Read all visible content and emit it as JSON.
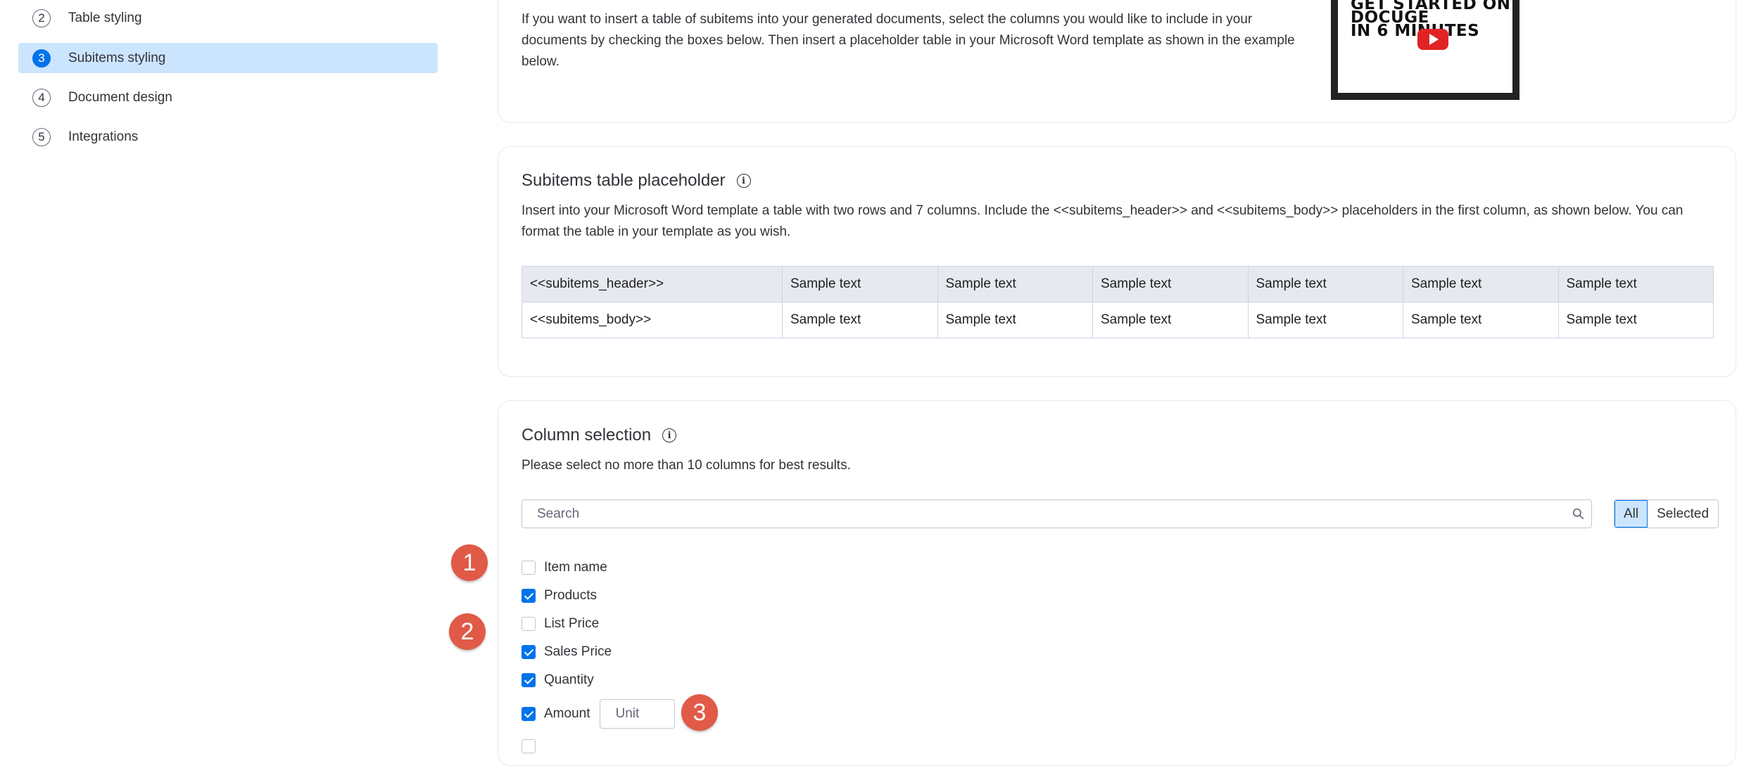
{
  "sidebar": {
    "steps": [
      {
        "number": "2",
        "label": "Table styling",
        "active": false
      },
      {
        "number": "3",
        "label": "Subitems styling",
        "active": true
      },
      {
        "number": "4",
        "label": "Document design",
        "active": false
      },
      {
        "number": "5",
        "label": "Integrations",
        "active": false
      }
    ]
  },
  "intro": {
    "text": "If you want to insert a table of subitems into your generated documents, select the columns you would like to include in your documents by checking the boxes below. Then insert a placeholder table in your Microsoft Word template as shown in the example below.",
    "video": {
      "line1": "GET STARTED ON",
      "line2": "DOCUGEN",
      "line3": "IN 6 MINUTES"
    }
  },
  "placeholder_section": {
    "title": "Subitems table placeholder",
    "description": "Insert into your Microsoft Word template a table with two rows and 7 columns. Include the <<subitems_header>> and <<subitems_body>> placeholders in the first column, as shown below. You can format the table in your template as you wish.",
    "table": {
      "rows": [
        [
          "<<subitems_header>>",
          "Sample text",
          "Sample text",
          "Sample text",
          "Sample text",
          "Sample text",
          "Sample text"
        ],
        [
          "<<subitems_body>>",
          "Sample text",
          "Sample text",
          "Sample text",
          "Sample text",
          "Sample text",
          "Sample text"
        ]
      ]
    }
  },
  "column_selection": {
    "title": "Column selection",
    "hint": "Please select no more than 10 columns for best results.",
    "search": {
      "placeholder": "Search",
      "value": ""
    },
    "filter": {
      "all_label": "All",
      "selected_label": "Selected",
      "active": "All"
    },
    "columns": [
      {
        "label": "Item name",
        "checked": false
      },
      {
        "label": "Products",
        "checked": true
      },
      {
        "label": "List Price",
        "checked": false
      },
      {
        "label": "Sales Price",
        "checked": true
      },
      {
        "label": "Quantity",
        "checked": true
      },
      {
        "label": "Amount",
        "checked": true,
        "unit_placeholder": "Unit"
      },
      {
        "label": "",
        "checked": false
      }
    ]
  },
  "annotations": [
    {
      "label": "1"
    },
    {
      "label": "2"
    },
    {
      "label": "3"
    }
  ],
  "colors": {
    "accent": "#0073ea",
    "active_bg": "#cce5ff",
    "marker": "#e05a47",
    "table_header_bg": "#e6e9ef"
  }
}
